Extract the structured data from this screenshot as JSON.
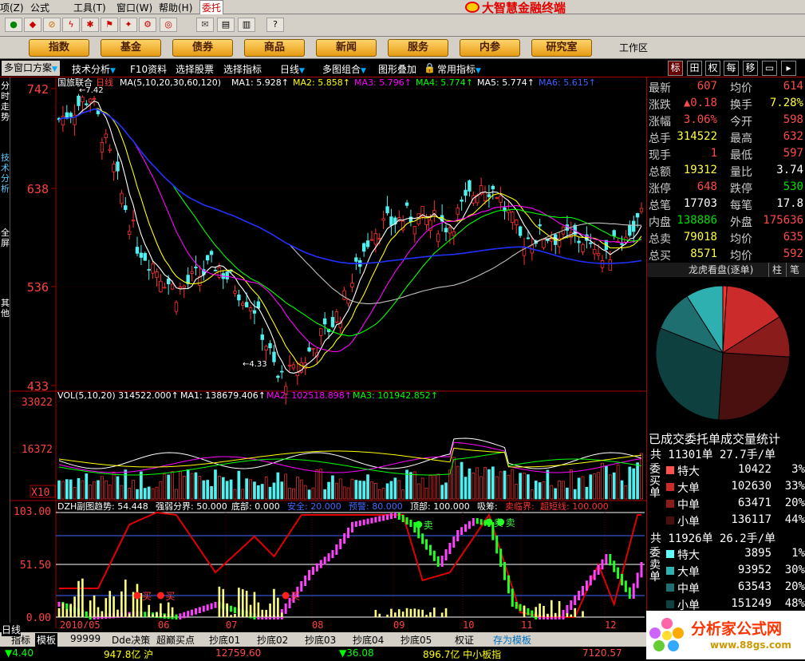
{
  "menu": {
    "items": [
      "项(Z)",
      "公式",
      "工具(T)",
      "窗口(W)",
      "帮助(H)",
      "委托"
    ],
    "brand": "大智慧金融终端"
  },
  "nav": {
    "buttons": [
      "指数",
      "基金",
      "债券",
      "商品",
      "新闻",
      "服务",
      "内参",
      "研究室"
    ],
    "workzone": "工作区"
  },
  "subbar": {
    "items": [
      "多窗口方案",
      "技术分析",
      "F10资料",
      "选择股票",
      "选择指标",
      "日线",
      "多图组合",
      "图形叠加",
      "常用指标"
    ],
    "right_tabs": [
      "标",
      "田",
      "权",
      "每",
      "移",
      "▭",
      "▸"
    ]
  },
  "left_tabs": [
    "分时走势",
    "技术分析",
    "全屏",
    "其他"
  ],
  "chart": {
    "stock": "国旅联合",
    "period": "日线",
    "ma_label": "MA(5,10,20,30,60,120)",
    "ma": [
      {
        "name": "MA1:",
        "value": "5.928",
        "color": "#ffffff"
      },
      {
        "name": "MA2:",
        "value": "5.858",
        "color": "#ffff00"
      },
      {
        "name": "MA3:",
        "value": "5.796",
        "color": "#ff00ff"
      },
      {
        "name": "MA4:",
        "value": "5.774",
        "color": "#00ff00"
      },
      {
        "name": "MA5:",
        "value": "5.774",
        "color": "#c0c0c0"
      },
      {
        "name": "MA6:",
        "value": "5.615",
        "color": "#0000ff"
      }
    ],
    "price_ticks": [
      "742",
      "638",
      "536",
      "433"
    ],
    "high_label": "7.42",
    "low_label": "4.33",
    "vol_label": "VOL(5,10,20)",
    "vol_value": "314522.000",
    "vol_ma": [
      {
        "name": "MA1:",
        "value": "138679.406",
        "color": "#ffffff"
      },
      {
        "name": "MA2:",
        "value": "102518.898",
        "color": "#ff00ff"
      },
      {
        "name": "MA3:",
        "value": "101942.852",
        "color": "#00ff00"
      }
    ],
    "vol_ticks": [
      "33022",
      "16372"
    ],
    "vol_unit": "X10",
    "dzh": {
      "label": "DZH副图",
      "items": [
        {
          "name": "趋势:",
          "value": "54.448",
          "color": "#ffffff"
        },
        {
          "name": "强弱分界:",
          "value": "50.000",
          "color": "#ffffff"
        },
        {
          "name": "底部:",
          "value": "0.000",
          "color": "#ffffff"
        },
        {
          "name": "安全:",
          "value": "20.000",
          "color": "#4169ff"
        },
        {
          "name": "预警:",
          "value": "80.000",
          "color": "#4169ff"
        },
        {
          "name": "顶部:",
          "value": "100.000",
          "color": "#ffffff"
        },
        {
          "name": "吸筹:",
          "value": "",
          "color": "#ffffff"
        },
        {
          "name": "卖临界:",
          "value": "",
          "color": "#ff3030"
        },
        {
          "name": "超短线:",
          "value": "100.000",
          "color": "#ff3030"
        }
      ],
      "ticks": [
        "103.00",
        "51.50",
        "0.00"
      ],
      "buy": "买",
      "sell": "卖"
    },
    "x_labels": [
      "2010/05",
      "06",
      "07",
      "08",
      "09",
      "10",
      "11",
      "12"
    ]
  },
  "quote": {
    "rows": [
      [
        "最新",
        "607",
        "均价",
        "614",
        "red",
        "red"
      ],
      [
        "涨跌",
        "▲0.18",
        "换手",
        "7.28%",
        "red",
        "yel"
      ],
      [
        "涨幅",
        "3.06%",
        "今开",
        "598",
        "red",
        "red"
      ],
      [
        "总手",
        "314522",
        "最高",
        "632",
        "yel",
        "red"
      ],
      [
        "现手",
        "1",
        "最低",
        "597",
        "red",
        "red"
      ],
      [
        "总额",
        "19312",
        "量比",
        "3.74",
        "yel",
        "wht"
      ],
      [
        "涨停",
        "648",
        "跌停",
        "530",
        "red",
        "grn"
      ],
      [
        "总笔",
        "17703",
        "每笔",
        "17.8",
        "wht",
        "wht"
      ],
      [
        "内盘",
        "138886",
        "外盘",
        "175636",
        "grn",
        "red"
      ],
      [
        "总卖",
        "79018",
        "均价",
        "635",
        "yel",
        "red"
      ],
      [
        "总买",
        "8571",
        "均价",
        "592",
        "yel",
        "red"
      ]
    ],
    "lh_title": "龙虎看盘(逐单)",
    "lh_tab1": "柱",
    "lh_tab2": "笔",
    "pie": [
      {
        "value": 1,
        "color": "#ff3030"
      },
      {
        "value": 15,
        "color": "#cc2b2b"
      },
      {
        "value": 10,
        "color": "#8a1c1c"
      },
      {
        "value": 25,
        "color": "#4a1010"
      },
      {
        "value": 30,
        "color": "#0f4040"
      },
      {
        "value": 10,
        "color": "#1e7070"
      },
      {
        "value": 9,
        "color": "#2fb0b0"
      }
    ],
    "stat_title": "已成交委托单成交量统计",
    "buy_head": "共 11301单 27.7手/单",
    "buy_label": "委买单",
    "buy": [
      [
        "特大",
        "10422",
        "3%",
        "#ff5050"
      ],
      [
        "大单",
        "102630",
        "33%",
        "#cc2b2b"
      ],
      [
        "中单",
        "63471",
        "20%",
        "#8a1c1c"
      ],
      [
        "小单",
        "136117",
        "44%",
        "#4a1010"
      ]
    ],
    "sell_head": "共 11926单 26.2手/单",
    "sell_label": "委卖单",
    "sell": [
      [
        "特大",
        "3895",
        "1%",
        "#5fffff"
      ],
      [
        "大单",
        "93952",
        "30%",
        "#2fb0b0"
      ],
      [
        "中单",
        "63543",
        "20%",
        "#1e7070"
      ],
      [
        "小单",
        "151249",
        "48%",
        "#0f4040"
      ]
    ]
  },
  "bottom": {
    "period_label": "日线",
    "tabs": [
      "指标",
      "模板",
      "99999",
      "Dde决策",
      "超巅买点",
      "抄底01",
      "抄底02",
      "抄底03",
      "抄底04",
      "抄底05",
      "权证",
      "存为模板"
    ]
  },
  "status": {
    "items": [
      "▼4.40",
      "947.8亿 沪",
      "12759.60",
      "▼36.08",
      "896.7亿 中小板指",
      "7120.57"
    ]
  },
  "watermark": {
    "title": "分析家公式网",
    "url": "www.88gs.com"
  }
}
